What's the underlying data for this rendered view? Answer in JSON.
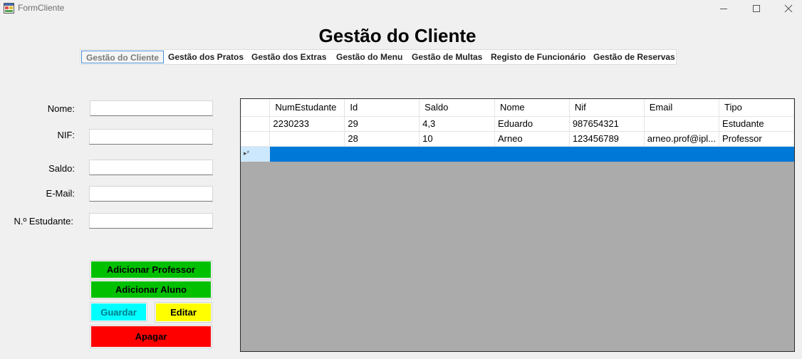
{
  "window": {
    "title": "FormCliente"
  },
  "page": {
    "title": "Gestão do Cliente"
  },
  "tabs": [
    {
      "label": "Gestão do Cliente",
      "active": true
    },
    {
      "label": "Gestão dos Pratos"
    },
    {
      "label": "Gestão dos Extras"
    },
    {
      "label": "Gestão do Menu"
    },
    {
      "label": "Gestão de Multas"
    },
    {
      "label": "Registo de Funcionário"
    },
    {
      "label": "Gestão de Reservas"
    }
  ],
  "form": {
    "nome": {
      "label": "Nome:",
      "value": ""
    },
    "nif": {
      "label": "NIF:",
      "value": ""
    },
    "saldo": {
      "label": "Saldo:",
      "value": ""
    },
    "email": {
      "label": "E-Mail:",
      "value": ""
    },
    "num_estudante": {
      "label": "N.º Estudante:",
      "value": ""
    }
  },
  "buttons": {
    "add_professor": {
      "label": "Adicionar Professor",
      "color": "#00c000"
    },
    "add_aluno": {
      "label": "Adicionar Aluno",
      "color": "#00c000"
    },
    "guardar": {
      "label": "Guardar",
      "color": "#00ffff"
    },
    "editar": {
      "label": "Editar",
      "color": "#ffff00"
    },
    "apagar": {
      "label": "Apagar",
      "color": "#ff0000"
    }
  },
  "grid": {
    "columns": [
      "NumEstudante",
      "Id",
      "Saldo",
      "Nome",
      "Nif",
      "Email",
      "Tipo"
    ],
    "rows": [
      [
        "2230233",
        "29",
        "4,3",
        "Eduardo",
        "987654321",
        "",
        "Estudante"
      ],
      [
        "",
        "28",
        "10",
        "Arneo",
        "123456789",
        "arneo.prof@ipl...",
        "Professor"
      ]
    ],
    "new_row_marker": "▸*",
    "selection_color": "#0078d7"
  }
}
